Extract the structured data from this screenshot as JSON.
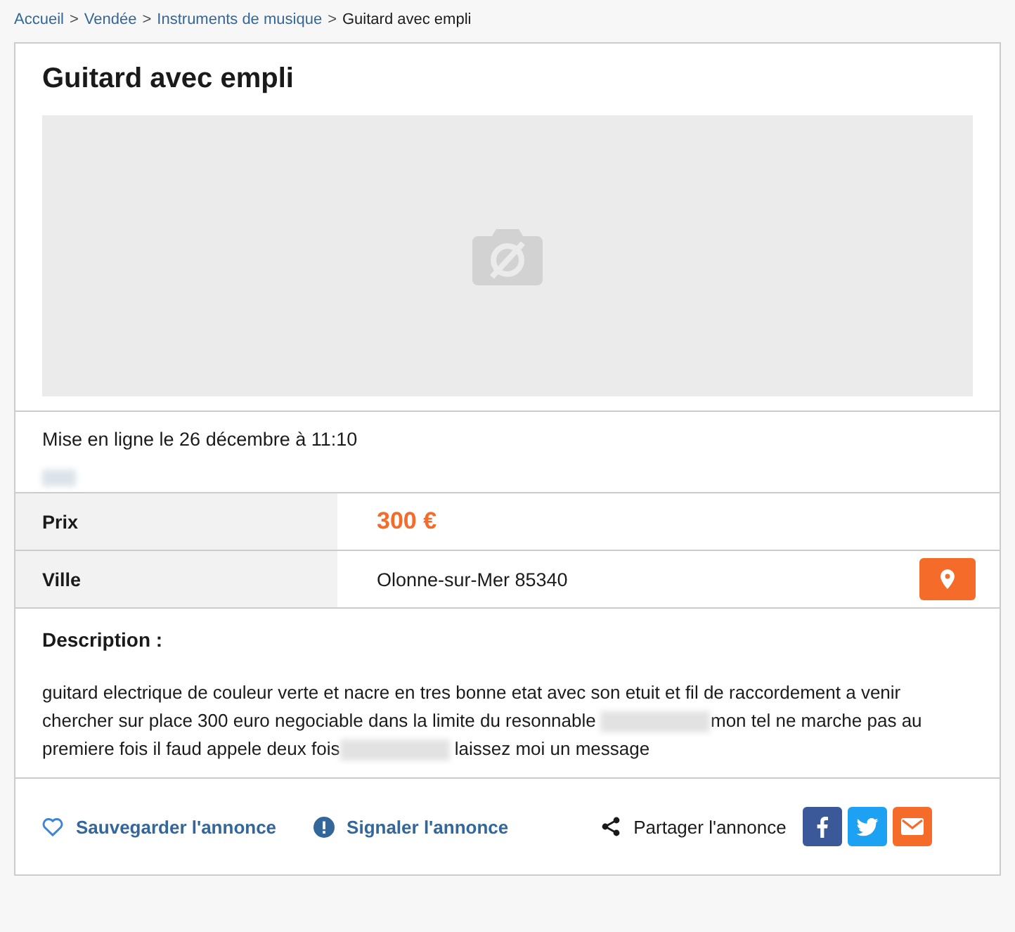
{
  "breadcrumb": [
    {
      "label": "Accueil",
      "link": true
    },
    {
      "label": "Vendée",
      "link": true
    },
    {
      "label": "Instruments de musique",
      "link": true
    },
    {
      "label": "Guitard avec empli",
      "link": false
    }
  ],
  "separator": ">",
  "ad": {
    "title": "Guitard avec empli",
    "image": {
      "kind": "placeholder"
    },
    "posted": "Mise en ligne le 26 décembre à 11:10",
    "posted_redacted": true
  },
  "details": [
    {
      "label": "Prix",
      "value": "300 €",
      "kind": "price"
    },
    {
      "label": "Ville",
      "value": "Olonne-sur-Mer 85340",
      "kind": "location"
    }
  ],
  "description": {
    "heading": "Description :",
    "parts": [
      {
        "kind": "text",
        "text": "guitard electrique de couleur verte et nacre en tres bonne etat avec son etuit et fil de raccordement a venir chercher sur place 300 euro negociable dans la limite du resonnable "
      },
      {
        "kind": "redacted"
      },
      {
        "kind": "text",
        "text": "mon tel ne marche pas au premiere fois il faud appele deux fois"
      },
      {
        "kind": "redacted"
      },
      {
        "kind": "text",
        "text": " laissez moi un message"
      }
    ]
  },
  "actions": [
    {
      "label": "Sauvegarder l'annonce",
      "kind": "save"
    },
    {
      "label": "Signaler l'annonce",
      "kind": "report"
    }
  ],
  "share": {
    "label": "Partager l'annonce",
    "networks": [
      {
        "kind": "facebook"
      },
      {
        "kind": "twitter"
      },
      {
        "kind": "email"
      }
    ]
  }
}
